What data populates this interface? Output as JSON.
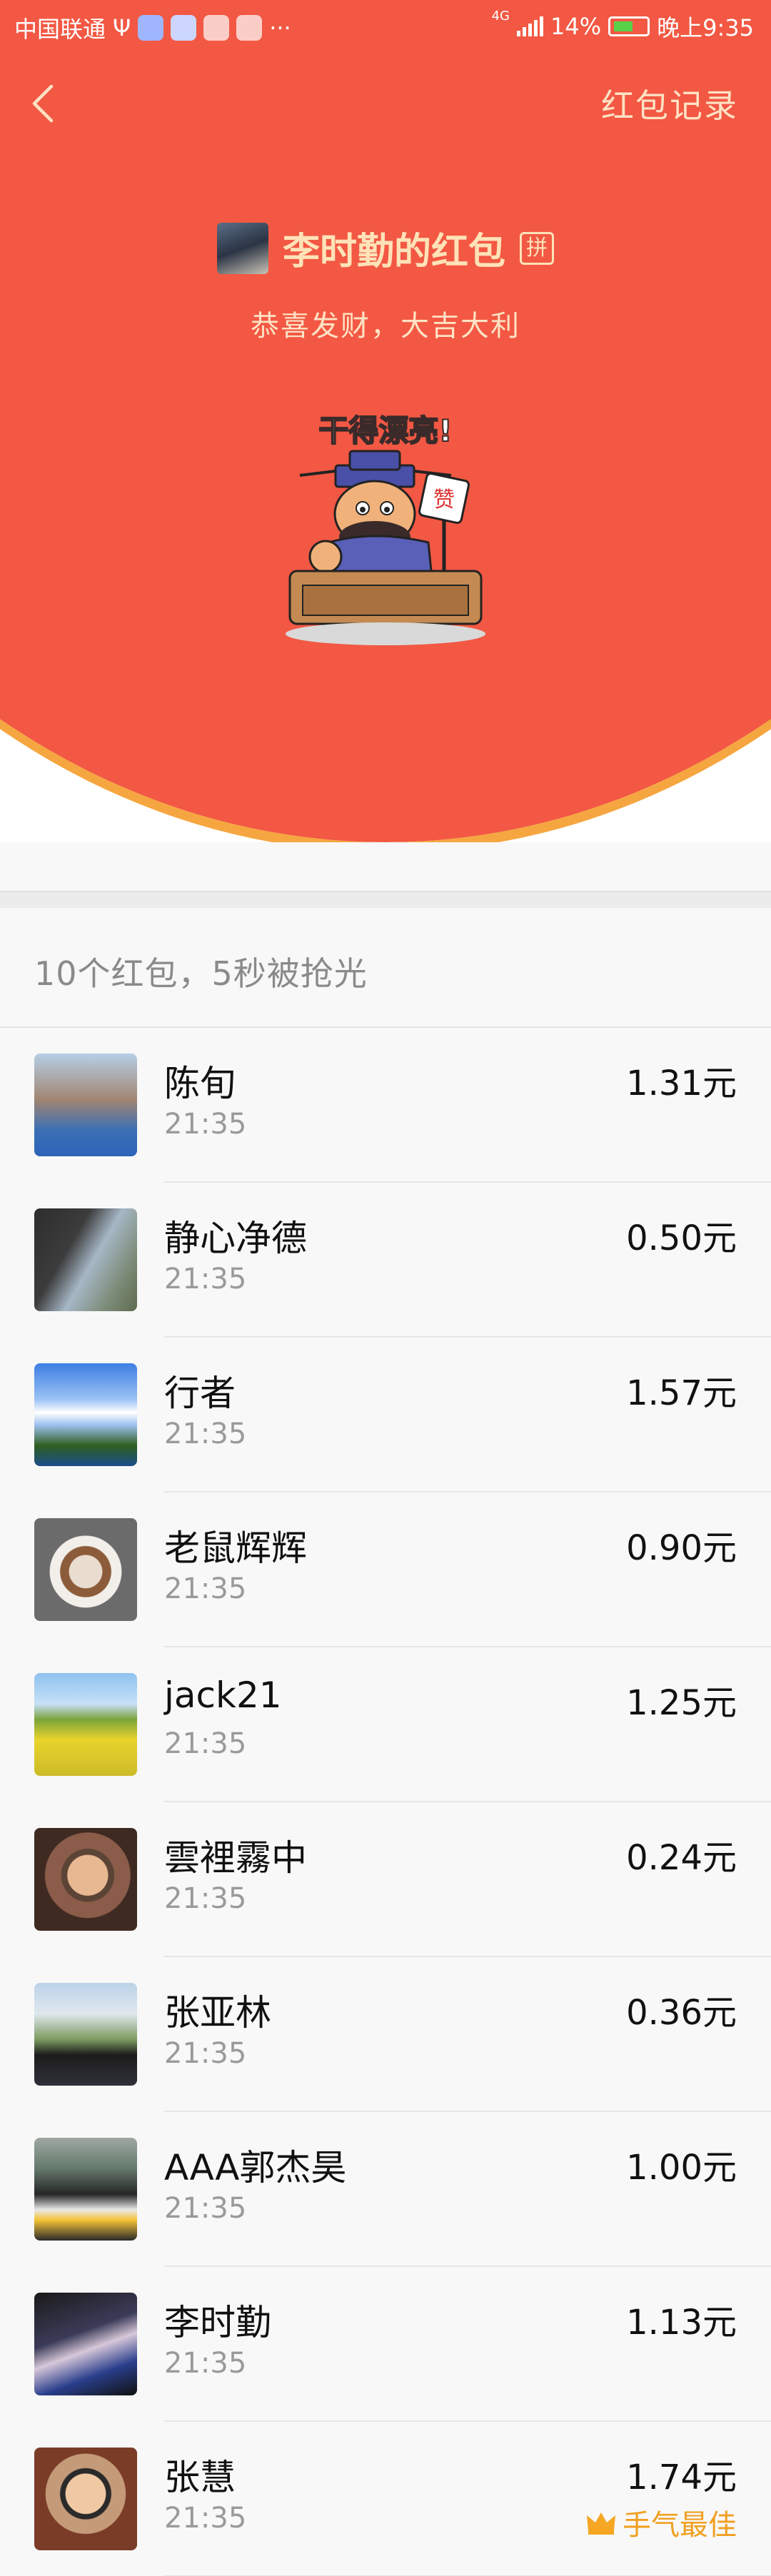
{
  "status_bar": {
    "carrier": "中国联通",
    "usb_symbol": "Ψ",
    "more": "···",
    "network": "4G",
    "battery": "14%",
    "time": "晚上9:35"
  },
  "nav": {
    "back_icon": "chevron-left-icon",
    "records_label": "红包记录"
  },
  "sender": {
    "name": "李时勤的红包",
    "pin_badge": "拼",
    "greeting": "恭喜发财，大吉大利"
  },
  "sticker": {
    "caption": "干得漂亮!",
    "sign_glyph": "赞"
  },
  "summary": "10个红包，5秒被抢光",
  "recipients": [
    {
      "name": "陈旬",
      "time": "21:35",
      "amount": "1.31元",
      "best": ""
    },
    {
      "name": "静心净德",
      "time": "21:35",
      "amount": "0.50元",
      "best": ""
    },
    {
      "name": "行者",
      "time": "21:35",
      "amount": "1.57元",
      "best": ""
    },
    {
      "name": "老鼠辉辉",
      "time": "21:35",
      "amount": "0.90元",
      "best": ""
    },
    {
      "name": "jack21",
      "time": "21:35",
      "amount": "1.25元",
      "best": ""
    },
    {
      "name": "雲裡霧中",
      "time": "21:35",
      "amount": "0.24元",
      "best": ""
    },
    {
      "name": "张亚林",
      "time": "21:35",
      "amount": "0.36元",
      "best": ""
    },
    {
      "name": "AAA郭杰昊",
      "time": "21:35",
      "amount": "1.00元",
      "best": ""
    },
    {
      "name": "李时勤",
      "time": "21:35",
      "amount": "1.13元",
      "best": ""
    },
    {
      "name": "张慧",
      "time": "21:35",
      "amount": "1.74元",
      "best": "手气最佳"
    }
  ],
  "colors": {
    "header_red": "#f25843",
    "header_gold_edge": "#f6a640",
    "greeting_text": "#ffe2c4",
    "best_luck": "#f0a020"
  }
}
